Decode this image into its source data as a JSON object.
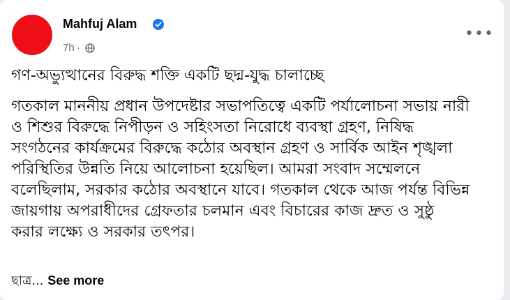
{
  "post": {
    "author": "Mahfuj Alam",
    "time": "7h",
    "separator": "·",
    "title": "গণ-অভ্যুত্থানের বিরুদ্ধ শক্তি একটি ছদ্ম-যুদ্ধ চালাচ্ছে",
    "body_lines": [
      "গতকাল মাননীয় প্রধান উপদেষ্টার সভাপতিত্বে একটি পর্যালোচনা সভায় নারী",
      "ও শিশুর বিরুদ্ধে নিপীড়ন ও সহিংসতা নিরোধে ব্যবস্থা গ্রহণ, নিষিদ্ধ",
      "সংগঠনের কার্যক্রমের বিরুদ্ধে কঠোর অবস্থান গ্রহণ ও সার্বিক আইন শৃঙ্খলা",
      "পরিস্থিতির উন্নতি নিয়ে আলোচনা হয়েছিল। আমরা সংবাদ সম্মেলনে",
      "বলেছিলাম, সরকার কঠোর অবস্থানে যাবে। গতকাল থেকে আজ পর্যন্ত বিভিন্ন",
      "জায়গায় অপরাধীদের গ্রেফতার চলমান এবং বিচারের কাজ দ্রুত ও সুষ্ঠু",
      "করার লক্ষ্যে ও সরকার তৎপর।"
    ],
    "truncated_text": "ছাত্র...",
    "see_more": "See more"
  },
  "icons": {
    "verified": "verified-badge-icon",
    "audience": "globe-icon",
    "more": "more-options-icon"
  },
  "colors": {
    "avatar": "#ee0e16",
    "verified": "#1877f2",
    "secondary_text": "#65676b"
  }
}
